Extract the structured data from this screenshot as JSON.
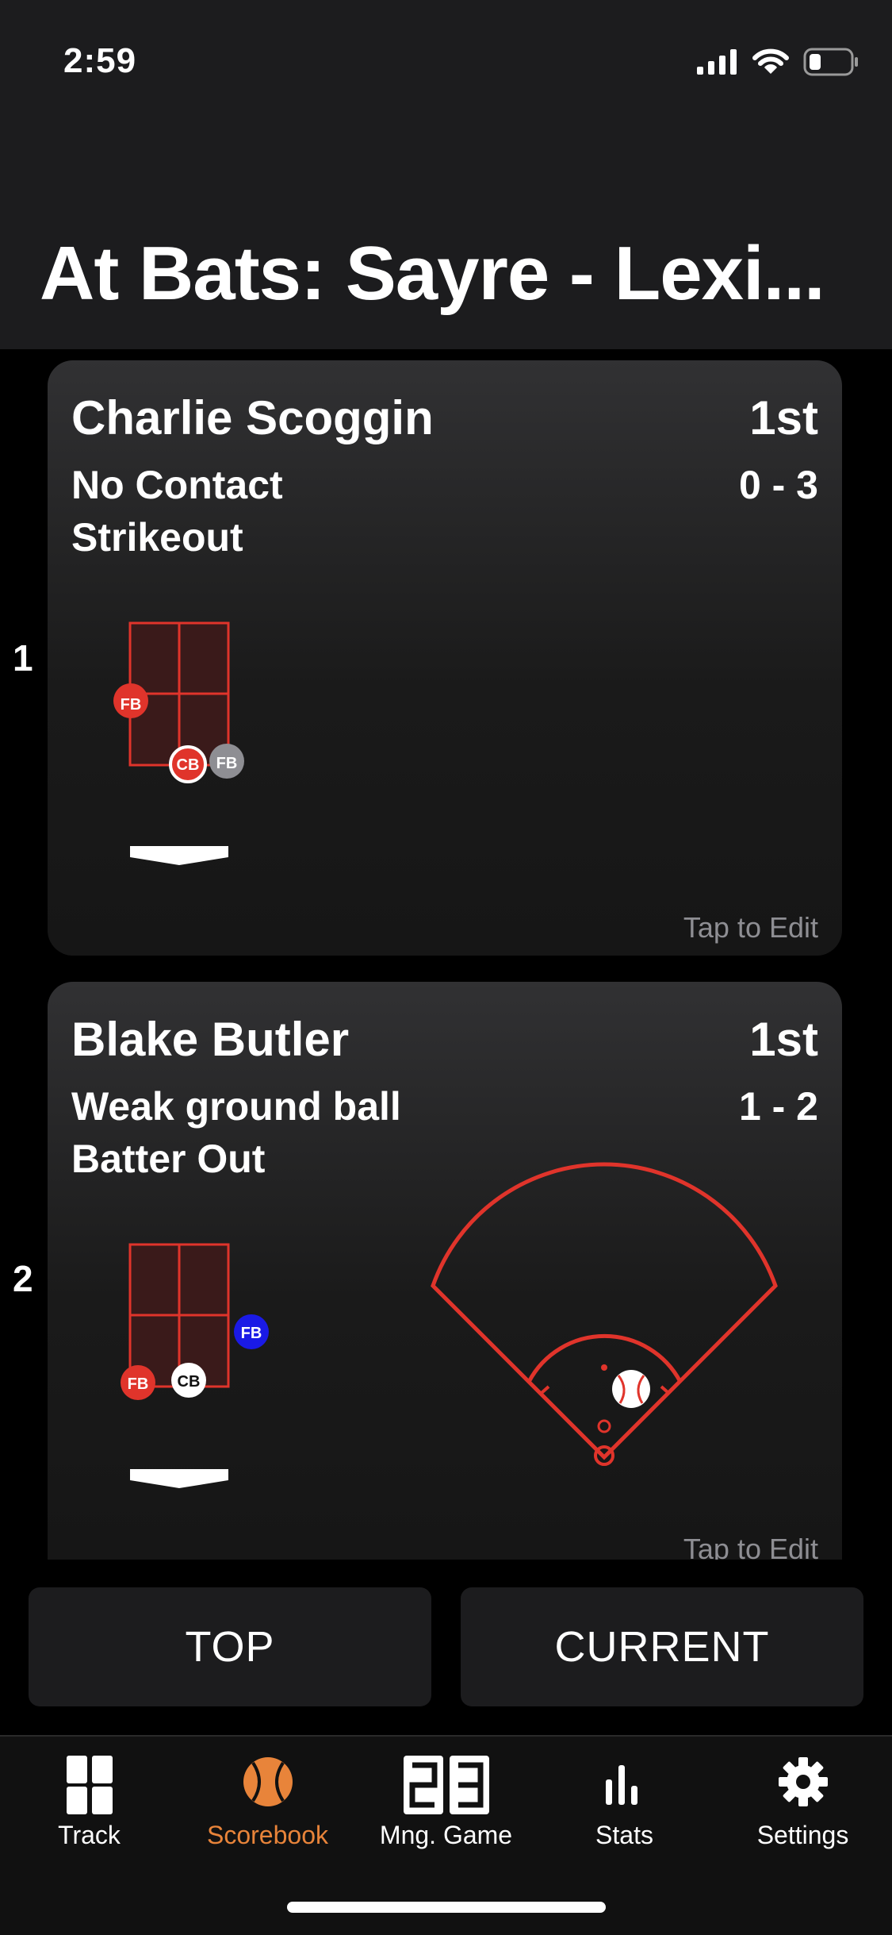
{
  "status_bar": {
    "time": "2:59"
  },
  "title": "At Bats: Sayre - Lexi...",
  "at_bats": [
    {
      "number": "1",
      "name": "Charlie Scoggin",
      "inning": "1st",
      "contact": "No Contact",
      "count": "0 - 3",
      "result": "Strikeout",
      "tap_label": "Tap to Edit",
      "pitches": [
        {
          "label": "FB",
          "color": "#e0342b",
          "ring": "none"
        },
        {
          "label": "CB",
          "color": "#e0342b",
          "ring": "white"
        },
        {
          "label": "FB",
          "color": "#8e8e93",
          "ring": "none"
        }
      ]
    },
    {
      "number": "2",
      "name": "Blake  Butler",
      "inning": "1st",
      "contact": "Weak ground ball",
      "count": "1 - 2",
      "result": "Batter Out",
      "tap_label": "Tap to Edit",
      "pitches": [
        {
          "label": "FB",
          "color": "#e0342b",
          "ring": "none"
        },
        {
          "label": "CB",
          "color": "#ffffff",
          "ring": "none"
        },
        {
          "label": "FB",
          "color": "#1a1ae6",
          "ring": "none"
        }
      ]
    }
  ],
  "buttons": {
    "top": "TOP",
    "current": "CURRENT"
  },
  "tabs": [
    {
      "label": "Track",
      "icon": "grid-icon",
      "active": false
    },
    {
      "label": "Scorebook",
      "icon": "baseball-icon",
      "active": true
    },
    {
      "label": "Mng. Game",
      "icon": "scoreboard-23-icon",
      "active": false
    },
    {
      "label": "Stats",
      "icon": "bar-chart-icon",
      "active": false
    },
    {
      "label": "Settings",
      "icon": "gear-icon",
      "active": false
    }
  ],
  "colors": {
    "accent": "#e8843a",
    "zone_line": "#e0342b",
    "field_line": "#e0342b"
  }
}
